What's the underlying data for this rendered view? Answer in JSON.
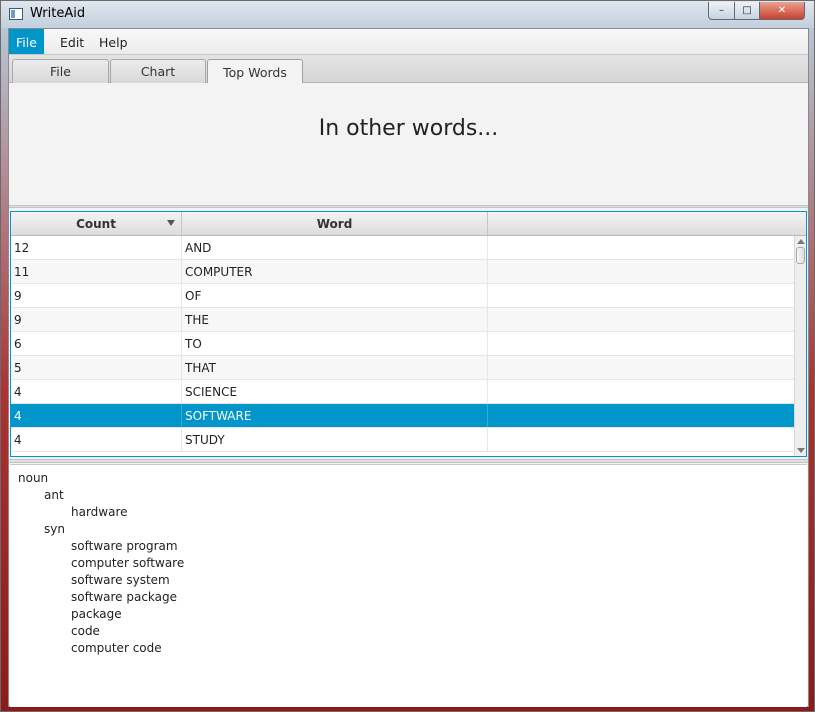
{
  "window": {
    "title": "WriteAid",
    "controls": {
      "minimize": "–",
      "maximize": "□",
      "close": "✕"
    }
  },
  "menu": {
    "items": [
      {
        "label": "File",
        "active": true
      },
      {
        "label": "Edit",
        "active": false
      },
      {
        "label": "Help",
        "active": false
      }
    ]
  },
  "tabs": [
    {
      "label": "File",
      "selected": false
    },
    {
      "label": "Chart",
      "selected": false
    },
    {
      "label": "Top Words",
      "selected": true
    }
  ],
  "banner": {
    "text": "In other words..."
  },
  "table": {
    "columns": [
      {
        "label": "Count",
        "sorted": "descending"
      },
      {
        "label": "Word"
      },
      {
        "label": ""
      }
    ],
    "rows": [
      {
        "count": "12",
        "word": "AND",
        "selected": false
      },
      {
        "count": "11",
        "word": "COMPUTER",
        "selected": false
      },
      {
        "count": "9",
        "word": "OF",
        "selected": false
      },
      {
        "count": "9",
        "word": "THE",
        "selected": false
      },
      {
        "count": "6",
        "word": "TO",
        "selected": false
      },
      {
        "count": "5",
        "word": "THAT",
        "selected": false
      },
      {
        "count": "4",
        "word": "SCIENCE",
        "selected": false
      },
      {
        "count": "4",
        "word": "SOFTWARE",
        "selected": true
      },
      {
        "count": "4",
        "word": "STUDY",
        "selected": false
      }
    ]
  },
  "synonyms": {
    "lines": [
      {
        "text": "noun",
        "level": 0
      },
      {
        "text": "ant",
        "level": 1
      },
      {
        "text": "hardware",
        "level": 2
      },
      {
        "text": "syn",
        "level": 1
      },
      {
        "text": "software program",
        "level": 2
      },
      {
        "text": "computer software",
        "level": 2
      },
      {
        "text": "software system",
        "level": 2
      },
      {
        "text": "software package",
        "level": 2
      },
      {
        "text": "package",
        "level": 2
      },
      {
        "text": "code",
        "level": 2
      },
      {
        "text": "computer code",
        "level": 2
      }
    ]
  },
  "colors": {
    "accent": "#0096c9"
  }
}
